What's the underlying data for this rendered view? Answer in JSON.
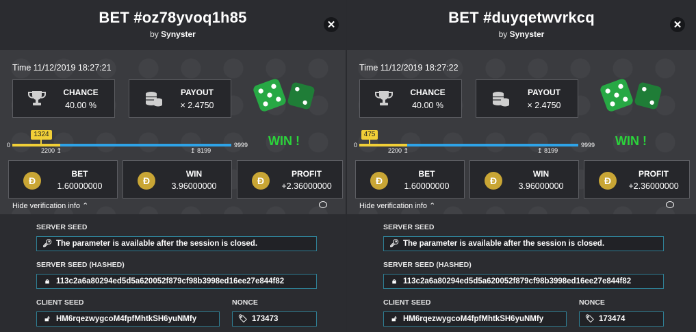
{
  "colors": {
    "accent_blue": "#2ea3e8",
    "accent_yellow": "#f1cf37",
    "win_green": "#2bd33b",
    "coin_gold": "#c9a635",
    "field_border": "#2f7f94"
  },
  "bets": [
    {
      "title": "BET #oz78yvoq1h85",
      "by_prefix": "by",
      "author": "Synyster",
      "time": "Time 11/12/2019 18:27:21",
      "chance_label": "CHANCE",
      "chance_value": "40.00 %",
      "payout_label": "PAYOUT",
      "payout_value": "× 2.4750",
      "roll": "1324",
      "roll_fraction": 0.1324,
      "range_min": "0",
      "range_max": "9999",
      "low_threshold": "2200",
      "high_threshold": "8199",
      "low_fraction": 0.22,
      "high_fraction": 0.82,
      "result": "WIN !",
      "bet_label": "BET",
      "bet_value": "1.60000000",
      "win_label": "WIN",
      "win_value": "3.96000000",
      "profit_label": "PROFIT",
      "profit_value": "+2.36000000",
      "coin_symbol": "Đ",
      "hide_verification": "Hide verification info",
      "server_seed_label": "SERVER SEED",
      "server_seed_value": "The parameter is available after the session is closed.",
      "hashed_label": "SERVER SEED (HASHED)",
      "hashed_value": "113c2a6a80294ed5d5a620052f879cf98b3998ed16ee27e844f82",
      "client_seed_label": "CLIENT SEED",
      "client_seed_value": "HM6rqezwygcoM4fpfMhtkSH6yuNMfy",
      "nonce_label": "NONCE",
      "nonce_value": "173473"
    },
    {
      "title": "BET #duyqetwvrkcq",
      "by_prefix": "by",
      "author": "Synyster",
      "time": "Time 11/12/2019 18:27:22",
      "chance_label": "CHANCE",
      "chance_value": "40.00 %",
      "payout_label": "PAYOUT",
      "payout_value": "× 2.4750",
      "roll": "475",
      "roll_fraction": 0.0475,
      "range_min": "0",
      "range_max": "9999",
      "low_threshold": "2200",
      "high_threshold": "8199",
      "low_fraction": 0.22,
      "high_fraction": 0.82,
      "result": "WIN !",
      "bet_label": "BET",
      "bet_value": "1.60000000",
      "win_label": "WIN",
      "win_value": "3.96000000",
      "profit_label": "PROFIT",
      "profit_value": "+2.36000000",
      "coin_symbol": "Đ",
      "hide_verification": "Hide verification info",
      "server_seed_label": "SERVER SEED",
      "server_seed_value": "The parameter is available after the session is closed.",
      "hashed_label": "SERVER SEED (HASHED)",
      "hashed_value": "113c2a6a80294ed5d5a620052f879cf98b3998ed16ee27e844f82",
      "client_seed_label": "CLIENT SEED",
      "client_seed_value": "HM6rqezwygcoM4fpfMhtkSH6yuNMfy",
      "nonce_label": "NONCE",
      "nonce_value": "173474"
    }
  ]
}
